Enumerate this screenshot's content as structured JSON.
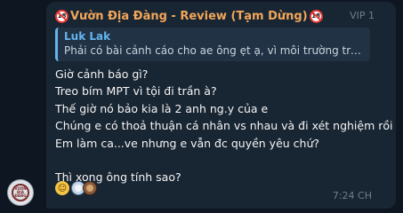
{
  "message": {
    "sender": "Vườn Địa Đàng - Review (Tạm Dừng)",
    "sender_badge": "18",
    "sender_color": "#f2a65a",
    "rank": "VIP 1",
    "reply": {
      "author": "Luk Lak",
      "text": "Phải có bài cảnh cáo cho ae ông ẹt ạ, vì môi trường tron..."
    },
    "lines": [
      "Giờ cảnh báo gì?",
      "Treo bím MPT vì tội đi trần à?",
      "Thế giờ nó bảo kia là 2 anh ng.y của e",
      "Chúng e có thoả thuận cá nhân vs nhau và đi xét nghiệm rồi",
      "Em làm ca...ve nhưng e vẫn đc quyền yêu chứ?",
      "",
      "Thì xong ông tính sao?"
    ],
    "reactions": [
      "laughing-emoji",
      "user-avatar",
      "user-avatar"
    ],
    "time": "7:24 CH"
  },
  "avatar": {
    "label": "VƯỜN ĐỊA ĐÀNG"
  },
  "colors": {
    "background": "#0e1621",
    "bubble": "#182533",
    "reply_accent": "#64b5ef",
    "muted": "#6d7f8f"
  }
}
